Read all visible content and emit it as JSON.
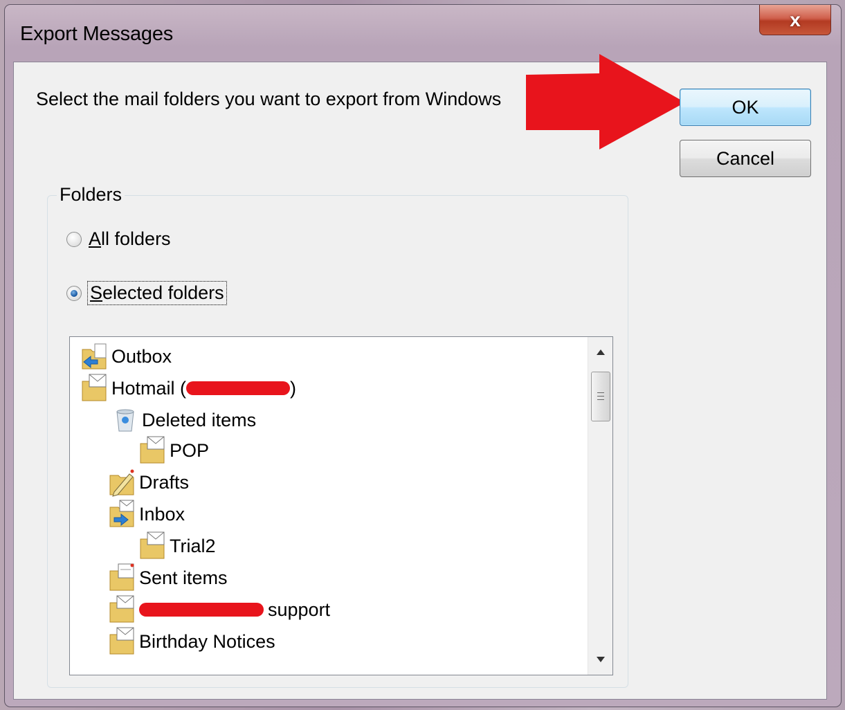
{
  "window": {
    "title": "Export Messages",
    "close_label": "x"
  },
  "dialog": {
    "instruction": "Select the mail folders you want to export from Windows",
    "ok_label": "OK",
    "cancel_label": "Cancel"
  },
  "folders_group": {
    "label": "Folders",
    "all_folders": {
      "accel": "A",
      "rest": "ll folders",
      "checked": false
    },
    "selected_folders": {
      "accel": "S",
      "rest": "elected folders",
      "checked": true
    }
  },
  "tree": {
    "items": [
      {
        "label": "Outbox",
        "icon": "outbox-folder-icon"
      },
      {
        "label": "Hotmail (",
        "suffix": ")",
        "icon": "mail-folder-icon",
        "redacted": true
      },
      {
        "label": "Deleted items",
        "icon": "recycle-bin-icon"
      },
      {
        "label": "POP",
        "icon": "mail-folder-icon"
      },
      {
        "label": "Drafts",
        "icon": "drafts-folder-icon"
      },
      {
        "label": "Inbox",
        "icon": "inbox-folder-icon"
      },
      {
        "label": "Trial2",
        "icon": "mail-folder-icon"
      },
      {
        "label": "Sent items",
        "icon": "sent-folder-icon"
      },
      {
        "label": "support",
        "icon": "mail-folder-icon",
        "redacted": true
      },
      {
        "label": "Birthday Notices",
        "icon": "mail-folder-icon"
      }
    ]
  },
  "colors": {
    "annotation_arrow": "#e8141c",
    "ok_border": "#3c7fb1"
  }
}
